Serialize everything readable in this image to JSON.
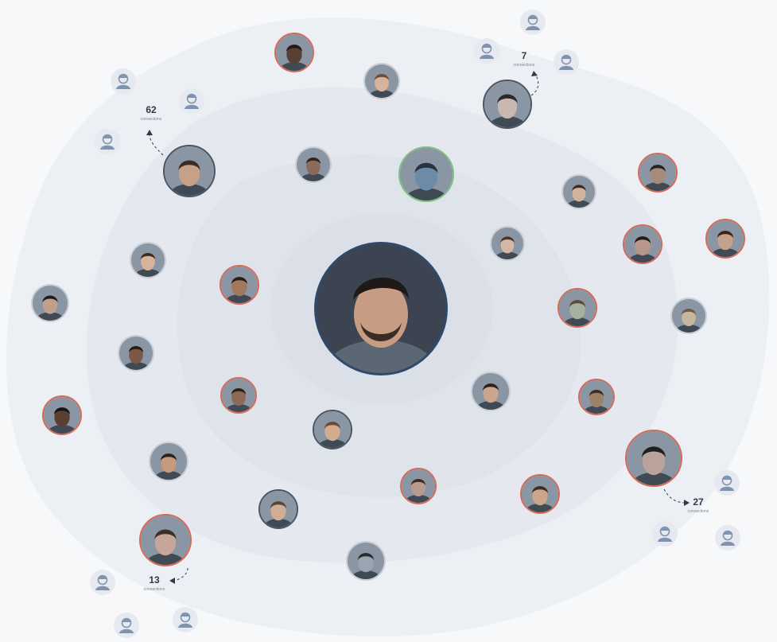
{
  "center": {
    "name": "center-avatar",
    "border": "#2f4a6b"
  },
  "clusters": [
    {
      "id": "top-right",
      "count": "7",
      "label": "connections"
    },
    {
      "id": "top-left",
      "count": "62",
      "label": "connections"
    },
    {
      "id": "right",
      "count": "27",
      "label": "connections"
    },
    {
      "id": "bottom-left",
      "count": "13",
      "label": "connections"
    }
  ],
  "colors": {
    "ring_outer": "#eceff4",
    "ring_mid": "#e4e8ef",
    "ring_inner": "#dde2ea",
    "core": "#d8dde6",
    "border_red": "#d46a5a",
    "border_green": "#7fbf7f",
    "border_dark": "#4b5563",
    "ghost_icon": "#7f93b0"
  },
  "avatars": [
    {
      "name": "avatar-top-1",
      "tone": "#5a3f37",
      "hair": "#1e1a1a",
      "border": "red"
    },
    {
      "name": "avatar-top-2",
      "tone": "#d7b39a",
      "hair": "#6b4f3a",
      "border": "none"
    },
    {
      "name": "avatar-top-3",
      "tone": "#c8b8b0",
      "hair": "#2a2a2a",
      "border": "dark"
    },
    {
      "name": "avatar-left-1",
      "tone": "#c7a187",
      "hair": "#3c2b22",
      "border": "dark"
    },
    {
      "name": "avatar-mid-1",
      "tone": "#8b6b5c",
      "hair": "#2d2320",
      "border": "none"
    },
    {
      "name": "avatar-mid-2",
      "tone": "#6d8aa6",
      "hair": "#243447",
      "border": "green"
    },
    {
      "name": "avatar-mid-3",
      "tone": "#b89179",
      "hair": "#3a2a22",
      "border": "none"
    },
    {
      "name": "avatar-right-1",
      "tone": "#a78a7a",
      "hair": "#232323",
      "border": "red"
    },
    {
      "name": "avatar-right-2",
      "tone": "#d2b39b",
      "hair": "#3e2c22",
      "border": "none"
    },
    {
      "name": "avatar-right-3",
      "tone": "#c4a189",
      "hair": "#352418",
      "border": "red"
    },
    {
      "name": "avatar-right-4",
      "tone": "#b8978a",
      "hair": "#221a16",
      "border": "red"
    },
    {
      "name": "avatar-left-2",
      "tone": "#d6b49c",
      "hair": "#3e2b20",
      "border": "none"
    },
    {
      "name": "avatar-mid-4",
      "tone": "#a2785d",
      "hair": "#2b1d16",
      "border": "red"
    },
    {
      "name": "avatar-left-3",
      "tone": "#bfa08d",
      "hair": "#1c1c1c",
      "border": "none"
    },
    {
      "name": "avatar-right-5",
      "tone": "#a6b2a0",
      "hair": "#5a4a3a",
      "border": "red"
    },
    {
      "name": "avatar-right-6",
      "tone": "#c6b6a0",
      "hair": "#6b5b4b",
      "border": "none"
    },
    {
      "name": "avatar-left-4",
      "tone": "#7a5845",
      "hair": "#2a1b14",
      "border": "none"
    },
    {
      "name": "avatar-mid-5",
      "tone": "#d4b8a4",
      "hair": "#4a3327",
      "border": "none"
    },
    {
      "name": "avatar-mid-6",
      "tone": "#8c6a58",
      "hair": "#2c211b",
      "border": "red"
    },
    {
      "name": "avatar-right-7",
      "tone": "#c9a68e",
      "hair": "#2b1f18",
      "border": "none"
    },
    {
      "name": "avatar-left-5",
      "tone": "#9c8068",
      "hair": "#3a2c22",
      "border": "red"
    },
    {
      "name": "avatar-mid-7",
      "tone": "#5a3f33",
      "hair": "#151515",
      "border": "red"
    },
    {
      "name": "avatar-right-8",
      "tone": "#d1ac90",
      "hair": "#6a4b38",
      "border": "dark"
    },
    {
      "name": "avatar-left-6",
      "tone": "#b9a39a",
      "hair": "#1f1f1f",
      "border": "red"
    },
    {
      "name": "avatar-mid-8",
      "tone": "#c79a7e",
      "hair": "#2b201a",
      "border": "none"
    },
    {
      "name": "avatar-right-9",
      "tone": "#b89a8e",
      "hair": "#3b2c26",
      "border": "red"
    },
    {
      "name": "avatar-mid-9",
      "tone": "#cba58c",
      "hair": "#3d2c22",
      "border": "red"
    },
    {
      "name": "avatar-left-7",
      "tone": "#d1ad96",
      "hair": "#5b4535",
      "border": "dark"
    },
    {
      "name": "avatar-bottom-1",
      "tone": "#c7a69a",
      "hair": "#3b2f2a",
      "border": "red"
    },
    {
      "name": "avatar-bottom-2",
      "tone": "#9aa7b2",
      "hair": "#2a2a2a",
      "border": "none"
    }
  ]
}
